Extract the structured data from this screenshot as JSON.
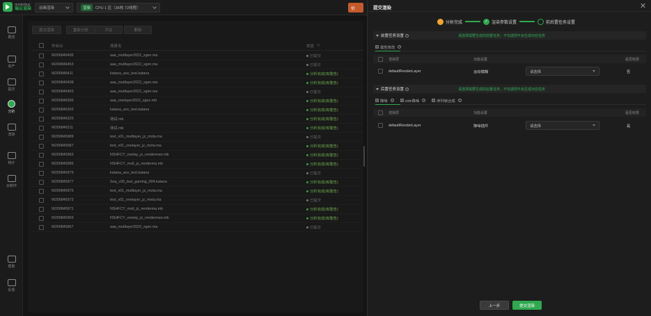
{
  "app": {
    "logo_en": "renderbus",
    "logo_cn": "瑞云渲染",
    "project_select": "动画渲染",
    "region_badge": "渲染",
    "region_select": "CPU 1 区（36核 72线程）",
    "orange_btn": "价"
  },
  "nav": [
    {
      "label": "概览",
      "icon": "dashboard-icon"
    },
    {
      "label": "资产",
      "icon": "folder-icon"
    },
    {
      "label": "提交",
      "icon": "upload-icon"
    },
    {
      "label": "分析",
      "icon": "analyze-icon"
    },
    {
      "label": "渲染",
      "icon": "play-icon"
    },
    {
      "label": "统计",
      "icon": "stats-icon"
    },
    {
      "label": "云制作",
      "icon": "monitor-icon"
    },
    {
      "label": "帮助",
      "icon": "help-doc-icon"
    },
    {
      "label": "反馈",
      "icon": "feedback-icon"
    }
  ],
  "toolbar": [
    "提交渲染",
    "重新分析",
    "开关",
    "删除"
  ],
  "table": {
    "headers": {
      "id": "作业ID",
      "name": "场景名",
      "status": "状态"
    },
    "rows": [
      {
        "id": "W200846495",
        "name": "aaa_multlayer2022_xgen.ma",
        "status": "已提交",
        "type": "submitted"
      },
      {
        "id": "W200846453",
        "name": "aaa_multlayer2022_xgen.ma",
        "status": "已提交",
        "type": "submitted"
      },
      {
        "id": "W200846411",
        "name": "katana_aov_test.katana",
        "status": "分析完成(有警告)",
        "type": "warning"
      },
      {
        "id": "W200846408",
        "name": "aaa_multlayer2022_xgen.ma",
        "status": "分析完成(有警告)",
        "type": "warning"
      },
      {
        "id": "W200846403",
        "name": "aaa_multlayer2022_xgen.ma",
        "status": "已提交",
        "type": "submitted"
      },
      {
        "id": "W200846395",
        "name": "aaa_onelayer2022_xgen.mb",
        "status": "分析完成(有警告)",
        "type": "warning"
      },
      {
        "id": "W200846393",
        "name": "katana_aov_test.katana",
        "status": "分析完成(有警告)",
        "type": "warning"
      },
      {
        "id": "W200846325",
        "name": "测试.mb",
        "status": "分析完成(有警告)",
        "type": "warning"
      },
      {
        "id": "W200846311",
        "name": "测试.mb",
        "status": "分析完成(有警告)",
        "type": "warning"
      },
      {
        "id": "W200845989",
        "name": "test_v01_multlayer_jz_mota.ma",
        "status": "已提交",
        "type": "submitted"
      },
      {
        "id": "W200845987",
        "name": "test_v01_onelayer_jz_mota.ma",
        "status": "分析完成(有警告)",
        "type": "warning"
      },
      {
        "id": "W200845983",
        "name": "NSHFCY_onelay_jz_renderman.mb",
        "status": "分析完成(有警告)",
        "type": "warning"
      },
      {
        "id": "W200845985",
        "name": "NSHFCY_mult_jz_renderma.mb",
        "status": "分析完成(有警告)",
        "type": "warning"
      },
      {
        "id": "W200845979",
        "name": "katana_aov_test.katana",
        "status": "已提交",
        "type": "submitted"
      },
      {
        "id": "W200845977",
        "name": "Seq_v30_test_gaming_004.katana",
        "status": "分析完成(有警告)",
        "type": "warning"
      },
      {
        "id": "W200845975",
        "name": "test_v01_multlayer_jz_mota.ma",
        "status": "分析完成(有警告)",
        "type": "warning"
      },
      {
        "id": "W200845973",
        "name": "test_v01_onelayer_jz_mota.ma",
        "status": "已提交",
        "type": "submitted"
      },
      {
        "id": "W200845971",
        "name": "NSHFCY_mult_jz_renderma.mb",
        "status": "分析完成(有警告)",
        "type": "warning"
      },
      {
        "id": "W200845969",
        "name": "NSHFCY_onelay_jz_renderman.mb",
        "status": "分析完成(有警告)",
        "type": "warning"
      },
      {
        "id": "W200845967",
        "name": "aaa_multlayer2022_xgen.ma",
        "status": "已提交",
        "type": "submitted"
      }
    ]
  },
  "modal": {
    "title": "提交渲染",
    "steps": [
      {
        "label": "分析完成",
        "state": "done"
      },
      {
        "label": "渲染参数设置",
        "state": "current"
      },
      {
        "label": "前后置任务设置",
        "state": "todo"
      }
    ],
    "pre_section": {
      "title": "前置任务设置",
      "note": "请选择需要生成的前置任务，不勾选则不会生成对应任务",
      "tab": "属性修改",
      "headers": {
        "layer": "渲染层",
        "func": "功能设置",
        "enable": "是否收费"
      },
      "row": {
        "layer": "defaultRenderLayer",
        "func": "运动模糊",
        "select": "请选择",
        "enable": "否"
      }
    },
    "post_section": {
      "title": "后置任务设置",
      "note": "请选择需要生成的后置任务，不勾选则不会生成对应任务",
      "tabs": [
        "降噪",
        "oidn降噪",
        "序列帧合成"
      ],
      "headers": {
        "layer": "渲染层",
        "func": "功能设置",
        "enable": "是否收费"
      },
      "row": {
        "layer": "defaultRenderLayer",
        "func": "降噪插件",
        "select": "请选择",
        "enable": "是"
      }
    },
    "buttons": {
      "prev": "上一步",
      "submit": "提交渲染"
    }
  },
  "colors": {
    "accent": "#2fa84f",
    "warning_text": "#6fae4f",
    "warning_dot": "#3a9a50",
    "submitted_dot": "#777777",
    "orange": "#c45a2c"
  }
}
